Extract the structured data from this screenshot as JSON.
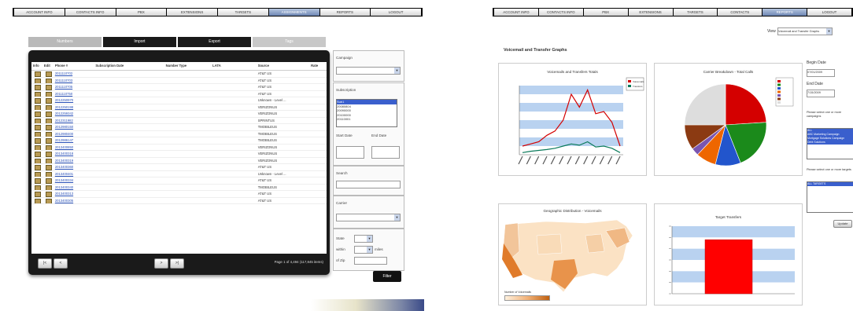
{
  "left_nav": {
    "tabs": [
      "ACCOUNT INFO",
      "CONTACTS INFO",
      "PBX",
      "EXTENSIONS",
      "TARGETS",
      "ASSIGNMENTS",
      "REPORTS",
      "LOGOUT"
    ],
    "active_index": 5
  },
  "left_subtabs": [
    "Numbers",
    "Import",
    "Export",
    "Tags"
  ],
  "grid": {
    "columns": [
      "Info",
      "Edit",
      "Phone #",
      "Subscription Date",
      "Number Type",
      "LATA",
      "Source",
      "Rate"
    ],
    "rows": [
      {
        "phone": "2011110702",
        "source": "AT&T US"
      },
      {
        "phone": "2011110703",
        "source": "AT&T US"
      },
      {
        "phone": "2011110705",
        "source": "AT&T US"
      },
      {
        "phone": "2011110750",
        "source": "AT&T US"
      },
      {
        "phone": "2012250970",
        "source": "Unknown - Level ..."
      },
      {
        "phone": "2012250198",
        "source": "VERIZONUS"
      },
      {
        "phone": "2012259342",
        "source": "VERIZONUS"
      },
      {
        "phone": "2012311982",
        "source": "SPRINTUS"
      },
      {
        "phone": "2012980150",
        "source": "TMOBILEUS"
      },
      {
        "phone": "2012980400",
        "source": "TMOBILEUS"
      },
      {
        "phone": "2012986147",
        "source": "TMOBILEUS"
      },
      {
        "phone": "2013400850",
        "source": "VERIZONUS"
      },
      {
        "phone": "2013400318",
        "source": "VERIZONUS"
      },
      {
        "phone": "2013400319",
        "source": "VERIZONUS"
      },
      {
        "phone": "2013400360",
        "source": "AT&T US"
      },
      {
        "phone": "2013400401",
        "source": "Unknown - Level ..."
      },
      {
        "phone": "2013400334",
        "source": "AT&T US"
      },
      {
        "phone": "2013400340",
        "source": "TMOBILEUS"
      },
      {
        "phone": "2013400313",
        "source": "AT&T US"
      },
      {
        "phone": "2013400305",
        "source": "AT&T US"
      }
    ],
    "pager_text": "Page 1 of 4,494 (117,845 items)",
    "pager_buttons": [
      "|<",
      "<",
      ">",
      ">|"
    ]
  },
  "filters": {
    "campaign_label": "Campaign",
    "subscription_label": "Subscription",
    "subscription_options": [
      "Sub1",
      "20080804",
      "20090000",
      "20100000",
      "20110001"
    ],
    "start_date_label": "Start Date",
    "end_date_label": "End Date",
    "search_label": "Search",
    "carrier_label": "Carrier",
    "state_label": "State",
    "within_label": "within",
    "miles_label": "miles",
    "of_zip_label": "of Zip",
    "go_label": "Filter"
  },
  "right_nav": {
    "tabs": [
      "ACCOUNT INFO",
      "CONTACTS INFO",
      "PBX",
      "EXTENSIONS",
      "TARGETS",
      "CONTACTS",
      "REPORTS",
      "LOGOUT"
    ],
    "active_index": 6
  },
  "view_label": "View",
  "view_select": "Voicemail and Transfer Graphs",
  "page_heading": "Voicemail and Transfer Graphs",
  "chart_data": [
    {
      "type": "line",
      "title": "Voicemails and Transfers Totals",
      "series": [
        {
          "name": "Voicemails",
          "values": [
            20,
            25,
            30,
            45,
            55,
            80,
            140,
            110,
            150,
            95,
            100,
            75,
            20
          ]
        },
        {
          "name": "Transfers",
          "values": [
            5,
            8,
            10,
            12,
            15,
            20,
            25,
            22,
            30,
            18,
            20,
            15,
            5
          ]
        }
      ],
      "series_colors": [
        "#d40000",
        "#0a7a5a"
      ],
      "ylim": [
        0,
        160
      ]
    },
    {
      "type": "pie",
      "title": "Carrier Breakdown - Total Calls",
      "slices": [
        {
          "value": 24,
          "color": "#d40000"
        },
        {
          "value": 20,
          "color": "#1b8a1b"
        },
        {
          "value": 10,
          "color": "#2255cc"
        },
        {
          "value": 8,
          "color": "#ee6600"
        },
        {
          "value": 3,
          "color": "#7a55b0"
        },
        {
          "value": 10,
          "color": "#8b3a12"
        },
        {
          "value": 25,
          "color": "#dddddd"
        }
      ]
    },
    {
      "type": "bar",
      "title": "Target Transfers",
      "values": [
        560
      ],
      "ylim": [
        0,
        700
      ],
      "bar_color": "#ff0000"
    }
  ],
  "map": {
    "title": "Geographic Distribution - Voicemails",
    "legend_label": "Number of Voicemails"
  },
  "right_side": {
    "begin_date_label": "Begin Date",
    "begin_date": "07/01/2009",
    "end_date_label": "End Date",
    "end_date": "7/15/2009",
    "campaigns_label": "Please select one or more campaigns",
    "campaign_options": [
      "ALL",
      "ABC Marketing Campaign",
      "Mortgage Solutions Campaign",
      "Debt Solutions"
    ],
    "targets_label": "Please select one or more targets",
    "target_options": [
      "ALL TARGETS"
    ],
    "update_label": "Update"
  }
}
